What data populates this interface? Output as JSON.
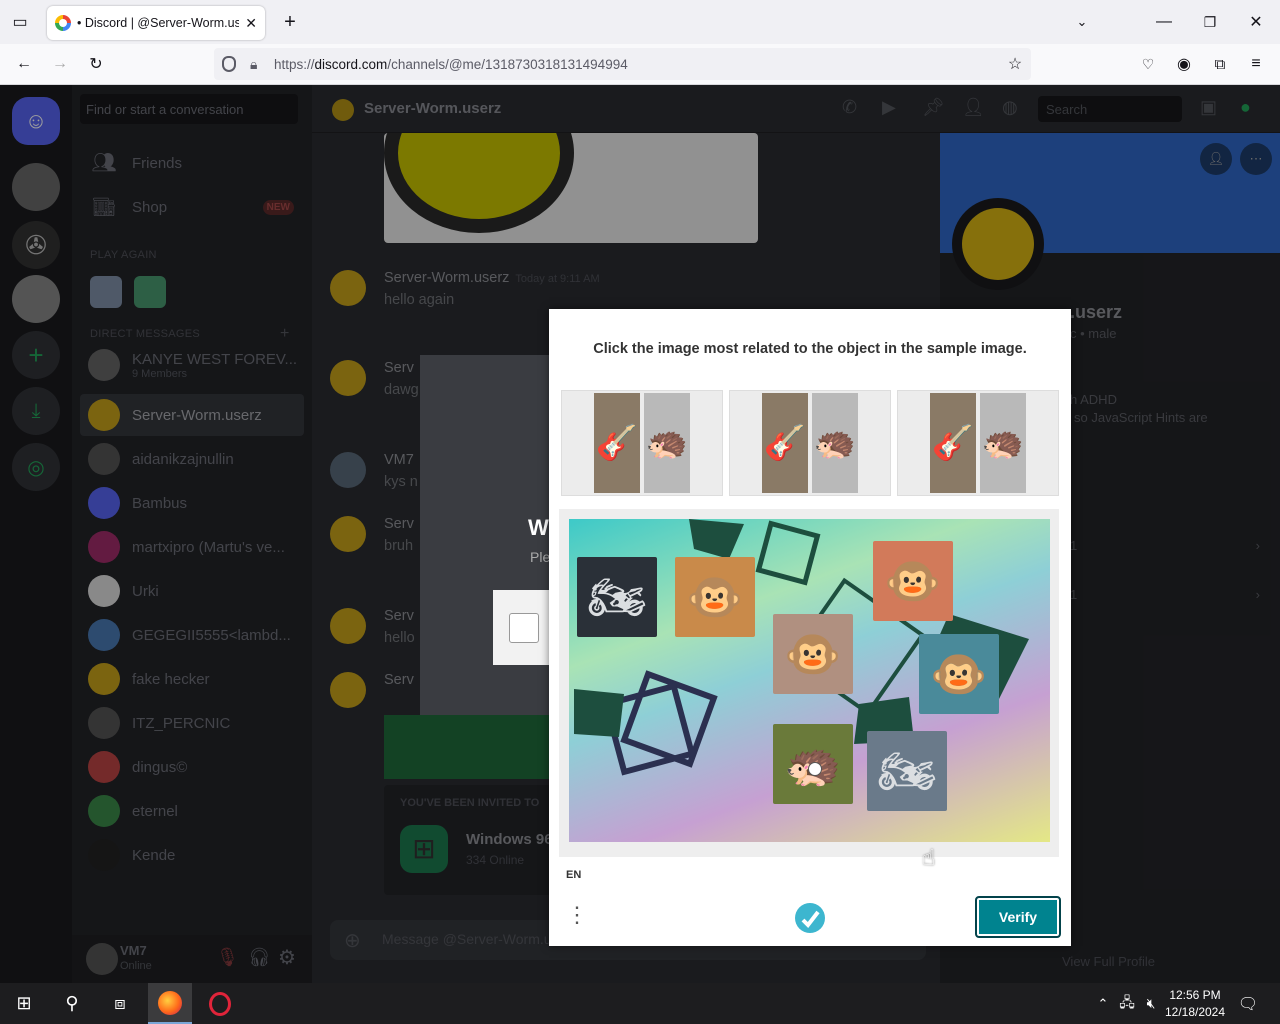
{
  "browser": {
    "tab_title": "• Discord | @Server-Worm.user",
    "url_prefix": "https://",
    "url_domain": "discord.com",
    "url_path": "/channels/@me/1318730318131494994"
  },
  "discord": {
    "find_placeholder": "Find or start a conversation",
    "nav": {
      "friends": "Friends",
      "shop": "Shop",
      "shop_badge": "NEW"
    },
    "play_again": "PLAY AGAIN",
    "direct_messages": "DIRECT MESSAGES",
    "dms": [
      {
        "name": "KANYE WEST FOREV...",
        "sub": "9 Members"
      },
      {
        "name": "Server-Worm.userz",
        "sub": ""
      },
      {
        "name": "aidanikzajnullin",
        "sub": ""
      },
      {
        "name": "Bambus",
        "sub": ""
      },
      {
        "name": "martxipro (Martu's ve...",
        "sub": ""
      },
      {
        "name": "Urki",
        "sub": ""
      },
      {
        "name": "GEGEGII5555<lambd...",
        "sub": ""
      },
      {
        "name": "fake hecker",
        "sub": ""
      },
      {
        "name": "ITZ_PERCNIC",
        "sub": ""
      },
      {
        "name": "dingus©",
        "sub": ""
      },
      {
        "name": "eternel",
        "sub": ""
      },
      {
        "name": "Kende",
        "sub": ""
      }
    ],
    "user": {
      "name": "VM7",
      "status": "Online"
    },
    "chat_header": "Server-Worm.userz",
    "search_placeholder": "Search",
    "messages": [
      {
        "user": "Server-Worm.userz",
        "time": "Today at 9:11 AM",
        "text": "hello again"
      },
      {
        "user": "Serv",
        "time": "",
        "text": "dawg"
      },
      {
        "user": "VM7",
        "time": "",
        "text": "kys n"
      },
      {
        "user": "Serv",
        "time": "",
        "text": "bruh"
      },
      {
        "user": "Serv",
        "time": "",
        "text": "hello"
      },
      {
        "user": "Serv",
        "time": "",
        "text": ""
      }
    ],
    "invite_label": "YOU'VE BEEN INVITED TO",
    "invite_server": "Windows 96",
    "invite_online": "334 Online",
    "composer_placeholder": "Message @Server-Worm.userz",
    "profile_name": ".userz",
    "profile_tags": "c • male",
    "profile_bio": "h ADHD",
    "profile_bio2": "so JavaScript Hints are",
    "profile_row1": "1",
    "profile_row2": "1",
    "view_full_profile": "View Full Profile"
  },
  "captcha": {
    "prompt": "Click the image most related to the object in the sample image.",
    "samples": [
      {
        "icons": [
          "guitar-icon",
          "hedgehog-icon"
        ]
      },
      {
        "icons": [
          "guitar-icon",
          "hedgehog-icon"
        ]
      },
      {
        "icons": [
          "guitar-icon",
          "hedgehog-icon"
        ]
      }
    ],
    "tiles": [
      {
        "label": "motorcycle",
        "emoji": "🏍"
      },
      {
        "label": "monkey",
        "emoji": "🐵"
      },
      {
        "label": "monkey",
        "emoji": "🐵"
      },
      {
        "label": "monkey",
        "emoji": "🐵"
      },
      {
        "label": "monkey",
        "emoji": "🐵"
      },
      {
        "label": "hedgehog",
        "emoji": "🦔"
      },
      {
        "label": "motorcycle",
        "emoji": "🏍"
      }
    ],
    "language": "EN",
    "verify_label": "Verify",
    "accent": "#00838f"
  },
  "taskbar": {
    "time": "12:56 PM",
    "date": "12/18/2024"
  }
}
